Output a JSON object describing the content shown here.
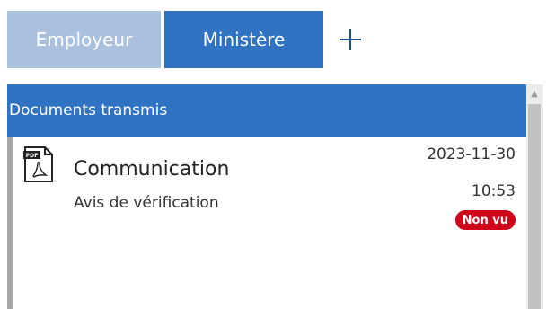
{
  "tabs": [
    {
      "label": "Employeur"
    },
    {
      "label": "Ministère"
    }
  ],
  "add_tab_icon": "plus-icon",
  "panel": {
    "header": "Documents transmis",
    "items": [
      {
        "icon": "pdf-file-icon",
        "title": "Communication",
        "subtitle": "Avis de vérification",
        "date": "2023-11-30",
        "time": "10:53",
        "status": "Non vu"
      }
    ]
  },
  "colors": {
    "active_tab": "#2f73c2",
    "inactive_tab": "#a9c1df",
    "header_bg": "#2f73c2",
    "badge": "#d0021b"
  }
}
